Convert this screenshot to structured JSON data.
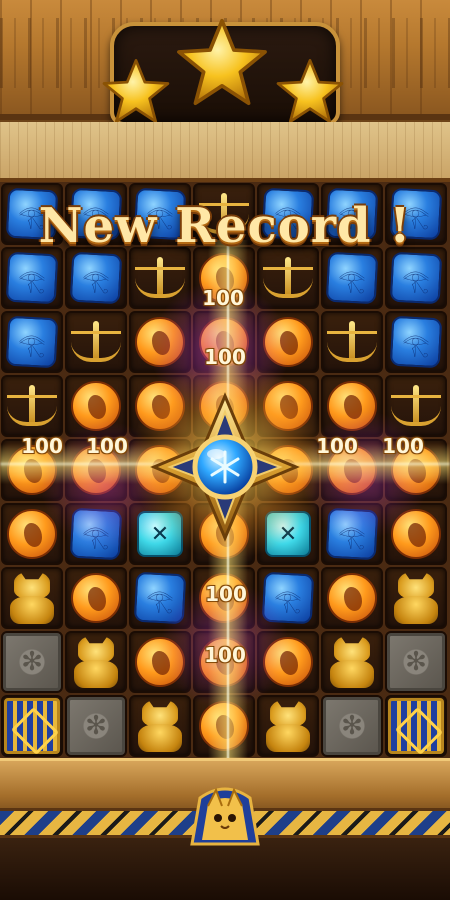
{
  "banner": {
    "title": "New Record !"
  },
  "stars": {
    "earned": 3,
    "total": 3,
    "color": "#f7c21f"
  },
  "booster": {
    "icon": "snowflake-orb-icon",
    "color": "#2fa8ff"
  },
  "scores": [
    "100",
    "100",
    "100",
    "100",
    "100",
    "100",
    "100",
    "100"
  ],
  "board": {
    "rows": 9,
    "cols": 7,
    "grid": [
      [
        "blue",
        "blue",
        "blue",
        "scale",
        "blue",
        "blue",
        "blue"
      ],
      [
        "blue",
        "blue",
        "scale",
        "orange",
        "scale",
        "blue",
        "blue"
      ],
      [
        "blue",
        "scale",
        "orange",
        "orange",
        "orange",
        "scale",
        "blue"
      ],
      [
        "scale",
        "orange",
        "orange",
        "orange",
        "orange",
        "orange",
        "scale"
      ],
      [
        "orange",
        "orange",
        "orange",
        "booster",
        "orange",
        "orange",
        "orange"
      ],
      [
        "orange",
        "blue",
        "cyan",
        "orange",
        "cyan",
        "blue",
        "orange"
      ],
      [
        "cat",
        "orange",
        "blue",
        "orange",
        "blue",
        "orange",
        "cat"
      ],
      [
        "stone",
        "cat",
        "orange",
        "orange",
        "orange",
        "cat",
        "stone"
      ],
      [
        "chest",
        "stone",
        "cat",
        "orange",
        "cat",
        "stone",
        "chest"
      ]
    ]
  },
  "colors": {
    "gold": "#e8b440",
    "blue_gem": "#2a7fe0",
    "orange_gem": "#ff9a1c",
    "cyan_gem": "#3fd8e8"
  }
}
